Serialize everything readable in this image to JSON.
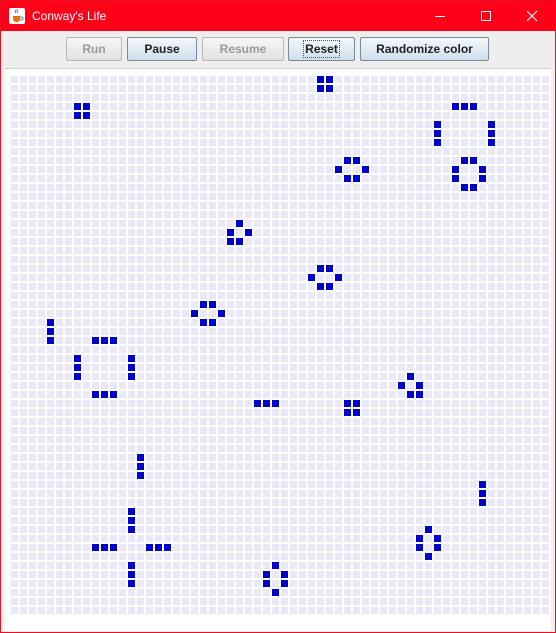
{
  "window": {
    "title": "Conway's Life",
    "app_icon": "java-cup-icon",
    "controls": [
      "minimize-icon",
      "maximize-icon",
      "close-icon"
    ],
    "titlebar_color": "#ff0019"
  },
  "toolbar": {
    "buttons": [
      {
        "id": "run",
        "label": "Run",
        "enabled": false
      },
      {
        "id": "pause",
        "label": "Pause",
        "enabled": true
      },
      {
        "id": "resume",
        "label": "Resume",
        "enabled": false
      },
      {
        "id": "reset",
        "label": "Reset",
        "enabled": true,
        "focused": true
      },
      {
        "id": "randomize",
        "label": "Randomize color",
        "enabled": true
      }
    ]
  },
  "board": {
    "columns": 60,
    "rows": 60,
    "dead_color": "#e8e8f8",
    "live_color": "#0000cc",
    "live_cells": [
      [
        34,
        0
      ],
      [
        35,
        0
      ],
      [
        34,
        1
      ],
      [
        35,
        1
      ],
      [
        7,
        3
      ],
      [
        8,
        3
      ],
      [
        7,
        4
      ],
      [
        8,
        4
      ],
      [
        49,
        3
      ],
      [
        50,
        3
      ],
      [
        51,
        3
      ],
      [
        47,
        5
      ],
      [
        53,
        5
      ],
      [
        47,
        6
      ],
      [
        53,
        6
      ],
      [
        47,
        7
      ],
      [
        53,
        7
      ],
      [
        37,
        9
      ],
      [
        38,
        9
      ],
      [
        36,
        10
      ],
      [
        39,
        10
      ],
      [
        37,
        11
      ],
      [
        38,
        11
      ],
      [
        50,
        9
      ],
      [
        51,
        9
      ],
      [
        49,
        10
      ],
      [
        52,
        10
      ],
      [
        49,
        11
      ],
      [
        52,
        11
      ],
      [
        50,
        12
      ],
      [
        51,
        12
      ],
      [
        25,
        16
      ],
      [
        24,
        17
      ],
      [
        26,
        17
      ],
      [
        24,
        18
      ],
      [
        25,
        18
      ],
      [
        34,
        21
      ],
      [
        35,
        21
      ],
      [
        33,
        22
      ],
      [
        36,
        22
      ],
      [
        34,
        23
      ],
      [
        35,
        23
      ],
      [
        21,
        25
      ],
      [
        22,
        25
      ],
      [
        20,
        26
      ],
      [
        23,
        26
      ],
      [
        21,
        27
      ],
      [
        22,
        27
      ],
      [
        4,
        27
      ],
      [
        4,
        28
      ],
      [
        4,
        29
      ],
      [
        9,
        29
      ],
      [
        10,
        29
      ],
      [
        11,
        29
      ],
      [
        7,
        31
      ],
      [
        13,
        31
      ],
      [
        7,
        32
      ],
      [
        13,
        32
      ],
      [
        7,
        33
      ],
      [
        13,
        33
      ],
      [
        44,
        33
      ],
      [
        43,
        34
      ],
      [
        45,
        34
      ],
      [
        44,
        35
      ],
      [
        45,
        35
      ],
      [
        9,
        35
      ],
      [
        10,
        35
      ],
      [
        11,
        35
      ],
      [
        27,
        36
      ],
      [
        28,
        36
      ],
      [
        29,
        36
      ],
      [
        37,
        36
      ],
      [
        38,
        36
      ],
      [
        37,
        37
      ],
      [
        38,
        37
      ],
      [
        14,
        42
      ],
      [
        14,
        43
      ],
      [
        14,
        44
      ],
      [
        52,
        45
      ],
      [
        52,
        46
      ],
      [
        52,
        47
      ],
      [
        13,
        48
      ],
      [
        13,
        49
      ],
      [
        13,
        50
      ],
      [
        46,
        50
      ],
      [
        45,
        51
      ],
      [
        47,
        51
      ],
      [
        45,
        52
      ],
      [
        47,
        52
      ],
      [
        46,
        53
      ],
      [
        9,
        52
      ],
      [
        10,
        52
      ],
      [
        11,
        52
      ],
      [
        15,
        52
      ],
      [
        16,
        52
      ],
      [
        17,
        52
      ],
      [
        13,
        54
      ],
      [
        13,
        55
      ],
      [
        13,
        56
      ],
      [
        29,
        54
      ],
      [
        28,
        55
      ],
      [
        30,
        55
      ],
      [
        28,
        56
      ],
      [
        30,
        56
      ],
      [
        29,
        57
      ]
    ]
  }
}
